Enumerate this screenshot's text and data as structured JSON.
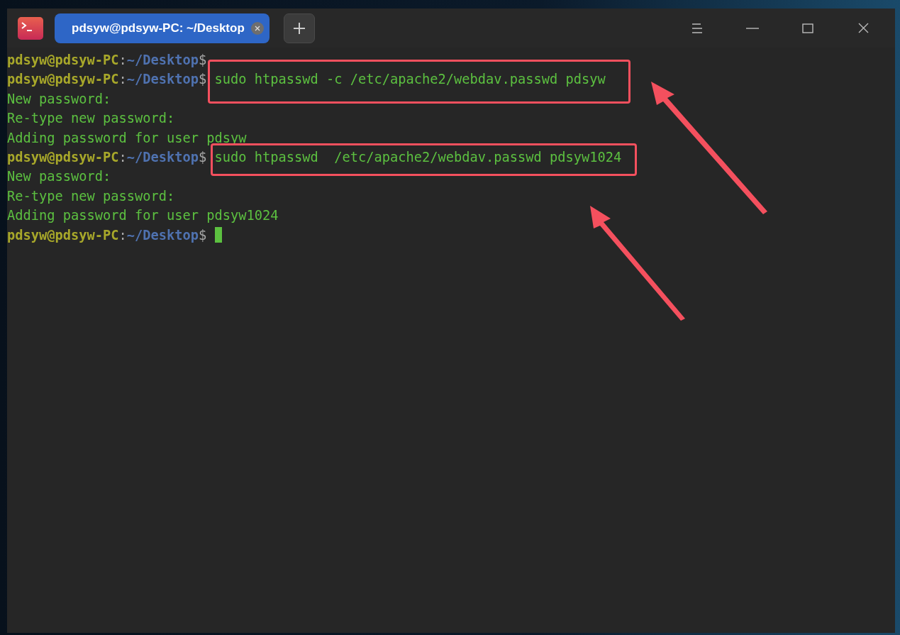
{
  "tabs": [
    {
      "title": "pdsyw@pdsyw-PC: ~/Desktop",
      "selected": true
    }
  ],
  "terminal": {
    "lines": [
      {
        "kind": "prompt",
        "user": "pdsyw@pdsyw-PC",
        "sep": ":",
        "path": "~/Desktop",
        "dollar": "$",
        "highlighted": false,
        "cursor": false
      },
      {
        "kind": "prompt",
        "user": "pdsyw@pdsyw-PC",
        "sep": ":",
        "path": "~/Desktop",
        "dollar": "$",
        "command": "sudo htpasswd -c /etc/apache2/webdav.passwd pdsyw",
        "highlighted": true,
        "cursor": false
      },
      {
        "kind": "output",
        "text": "New password:"
      },
      {
        "kind": "output",
        "text": "Re-type new password:"
      },
      {
        "kind": "output",
        "text": "Adding password for user pdsyw"
      },
      {
        "kind": "prompt",
        "user": "pdsyw@pdsyw-PC",
        "sep": ":",
        "path": "~/Desktop",
        "dollar": "$",
        "command": "sudo htpasswd  /etc/apache2/webdav.passwd pdsyw1024",
        "highlighted": true,
        "cursor": false
      },
      {
        "kind": "output",
        "text": "New password:"
      },
      {
        "kind": "output",
        "text": "Re-type new password:"
      },
      {
        "kind": "output",
        "text": "Adding password for user pdsyw1024"
      },
      {
        "kind": "prompt",
        "user": "pdsyw@pdsyw-PC",
        "sep": ":",
        "path": "~/Desktop",
        "dollar": "$",
        "highlighted": false,
        "cursor": true
      }
    ]
  }
}
